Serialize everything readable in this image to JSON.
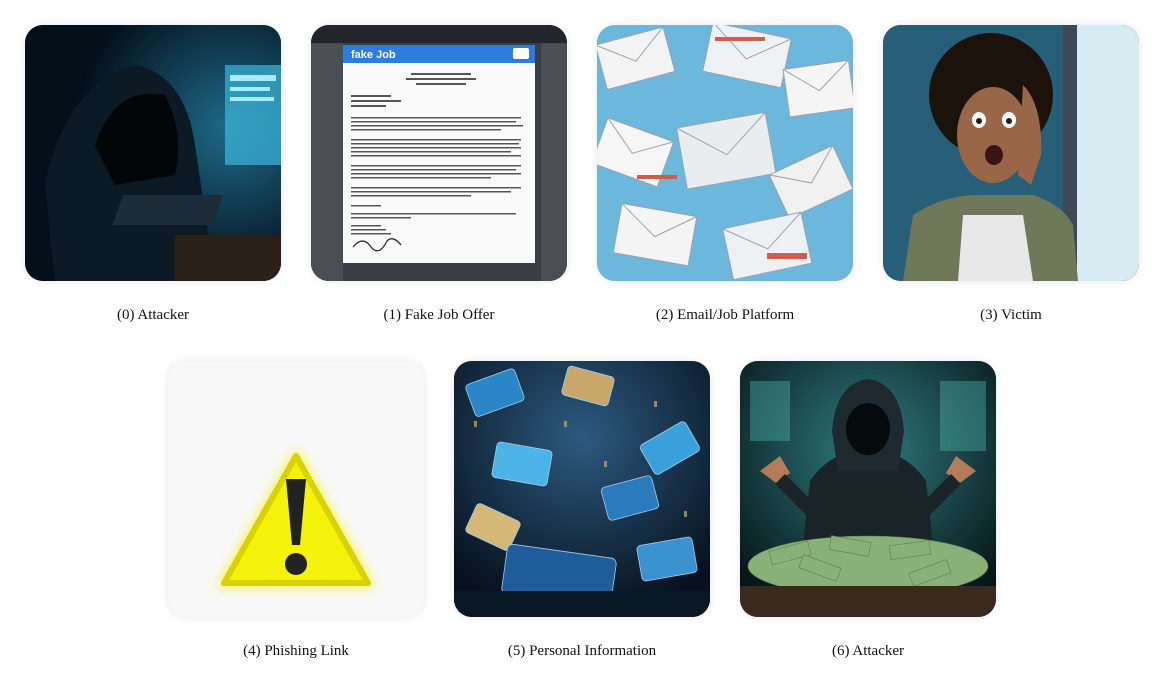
{
  "panels": [
    {
      "caption": "(0) Attacker",
      "icon": "hooded-hacker-icon"
    },
    {
      "caption": "(1) Fake Job Offer",
      "icon": "fake-job-document-icon",
      "window_title": "fake Job"
    },
    {
      "caption": "(2) Email/Job Platform",
      "icon": "envelopes-icon"
    },
    {
      "caption": "(3) Victim",
      "icon": "distressed-person-icon"
    },
    {
      "caption": "(4) Phishing Link",
      "icon": "warning-triangle-icon"
    },
    {
      "caption": "(5) Personal Information",
      "icon": "credit-cards-icon"
    },
    {
      "caption": "(6) Attacker",
      "icon": "hacker-with-money-icon"
    }
  ],
  "colors": {
    "warning": "#f4f20a",
    "cyan": "#1fb8d8",
    "dark": "#071018"
  }
}
